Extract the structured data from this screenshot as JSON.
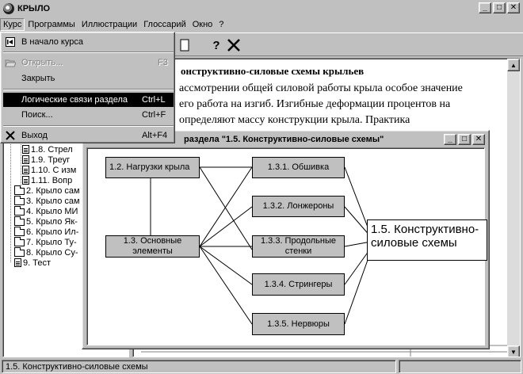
{
  "window": {
    "title": "КРЫЛО",
    "controls": {
      "minimize": "_",
      "maximize": "□",
      "close": "✕"
    }
  },
  "menubar": [
    "Курс",
    "Программы",
    "Иллюстрации",
    "Глоссарий",
    "Окно",
    "?"
  ],
  "toolbar": {
    "help_glyph": "?",
    "close_glyph": "✕"
  },
  "course_menu": {
    "items": [
      {
        "label": "В начало курса",
        "shortcut": "",
        "icon": "go-to-start-icon",
        "state": "normal"
      },
      {
        "label": "Открыть...",
        "shortcut": "F3",
        "icon": "open-folder-icon",
        "state": "disabled"
      },
      {
        "label": "Закрыть",
        "shortcut": "",
        "icon": "",
        "state": "normal"
      },
      {
        "label": "Логические связи раздела",
        "shortcut": "Ctrl+L",
        "icon": "",
        "state": "selected"
      },
      {
        "label": "Поиск...",
        "shortcut": "Ctrl+F",
        "icon": "",
        "state": "normal"
      },
      {
        "label": "Выход",
        "shortcut": "Alt+F4",
        "icon": "exit-icon",
        "state": "normal"
      }
    ]
  },
  "tree": {
    "items": [
      {
        "label": "1.8. Стрел",
        "type": "doc"
      },
      {
        "label": "1.9. Треуг",
        "type": "doc"
      },
      {
        "label": "1.10. С изм",
        "type": "doc"
      },
      {
        "label": "1.11. Вопр",
        "type": "doc"
      },
      {
        "label": "2. Крыло сам",
        "type": "folder"
      },
      {
        "label": "3. Крыло сам",
        "type": "folder"
      },
      {
        "label": "4. Крыло МИ",
        "type": "folder"
      },
      {
        "label": "5. Крыло Як-",
        "type": "folder"
      },
      {
        "label": "6. Крыло Ил-",
        "type": "folder"
      },
      {
        "label": "7. Крыло Ту-",
        "type": "folder"
      },
      {
        "label": "8. Крыло Су-",
        "type": "folder"
      },
      {
        "label": "9. Тест",
        "type": "doc"
      }
    ]
  },
  "content": {
    "heading": "онструктивно-силовые схемы крыльев",
    "lines": [
      "ассмотрении общей силовой работы крыла особое значение",
      "его работа на изгиб. Изгибные деформации процентов на",
      "определяют массу конструкции крыла. Практика"
    ]
  },
  "dialog": {
    "title": "раздела \"1.5. Конструктивно-силовые схемы\"",
    "nodes": {
      "loads": "1.2. Нагрузки крыла",
      "main_elements": "1.3. Основные элементы",
      "skin": "1.3.1. Обшивка",
      "spars": "1.3.2. Лонжероны",
      "walls": "1.3.3. Продольные стенки",
      "stringers": "1.3.4. Стрингеры",
      "ribs": "1.3.5. Нервюры"
    },
    "callout": "1.5. Конструктивно-силовые схемы"
  },
  "statusbar": {
    "text": "1.5. Конструктивно-силовые схемы"
  }
}
